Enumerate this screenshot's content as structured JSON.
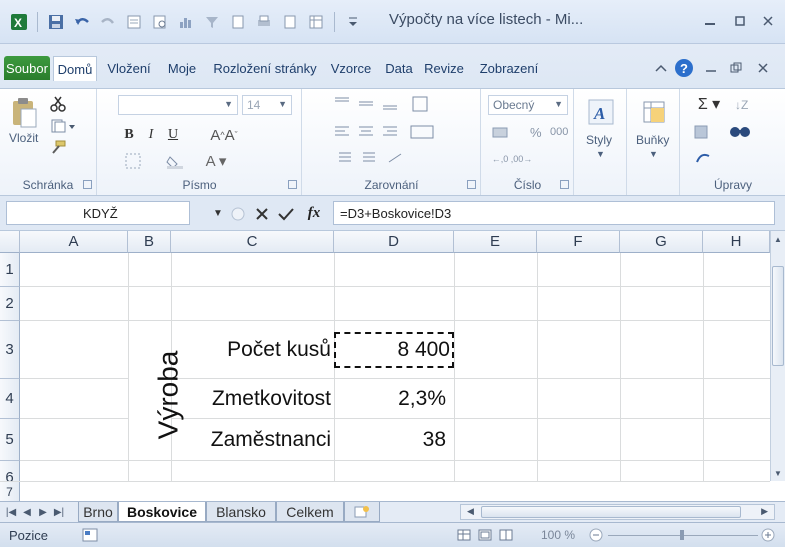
{
  "window": {
    "title": "Výpočty na více listech - Mi...",
    "icons": [
      "excel-icon",
      "save-icon",
      "undo-icon",
      "redo-icon",
      "print-preview-icon",
      "chart-icon",
      "filter-icon",
      "minimize-icon",
      "restore-icon",
      "close-icon"
    ]
  },
  "ribbon_tabs": [
    "Soubor",
    "Domů",
    "Vložení",
    "Moje",
    "Rozložení stránky",
    "Vzorce",
    "Data",
    "Revize",
    "Zobrazení"
  ],
  "ribbon": {
    "groups": {
      "clipboard": "Schránka",
      "font": "Písmo",
      "alignment": "Zarovnání",
      "number": "Číslo",
      "editing": "Úpravy"
    },
    "paste_label": "Vložit",
    "font_size": "14",
    "number_format": "Obecný",
    "percent": "%",
    "thousands": "000",
    "styles_label": "Styly",
    "cells_label": "Buňky",
    "bold": "B",
    "italic": "I",
    "underline": "U"
  },
  "formula_bar": {
    "name_box": "KDYŽ",
    "fx": "fx",
    "formula": "=D3+Boskovice!D3"
  },
  "grid": {
    "columns": [
      "A",
      "B",
      "C",
      "D",
      "E",
      "F",
      "G",
      "H"
    ],
    "rows": [
      "1",
      "2",
      "3",
      "4",
      "5",
      "6",
      "7"
    ],
    "vertical_label": "Výroba",
    "cells": {
      "C3": "Počet kusů",
      "D3": "8 400",
      "C4": "Zmetkovitost",
      "D4": "2,3%",
      "C5": "Zaměstnanci",
      "D5": "38"
    }
  },
  "sheet_tabs": [
    "Brno",
    "Boskovice",
    "Blansko",
    "Celkem"
  ],
  "active_sheet": "Boskovice",
  "status": {
    "mode": "Pozice",
    "zoom": "100 %"
  },
  "colors": {
    "file_tab": "#2a7d2c",
    "ribbon_bg": "#dfe8f4",
    "grid_line": "#dadcdd"
  }
}
